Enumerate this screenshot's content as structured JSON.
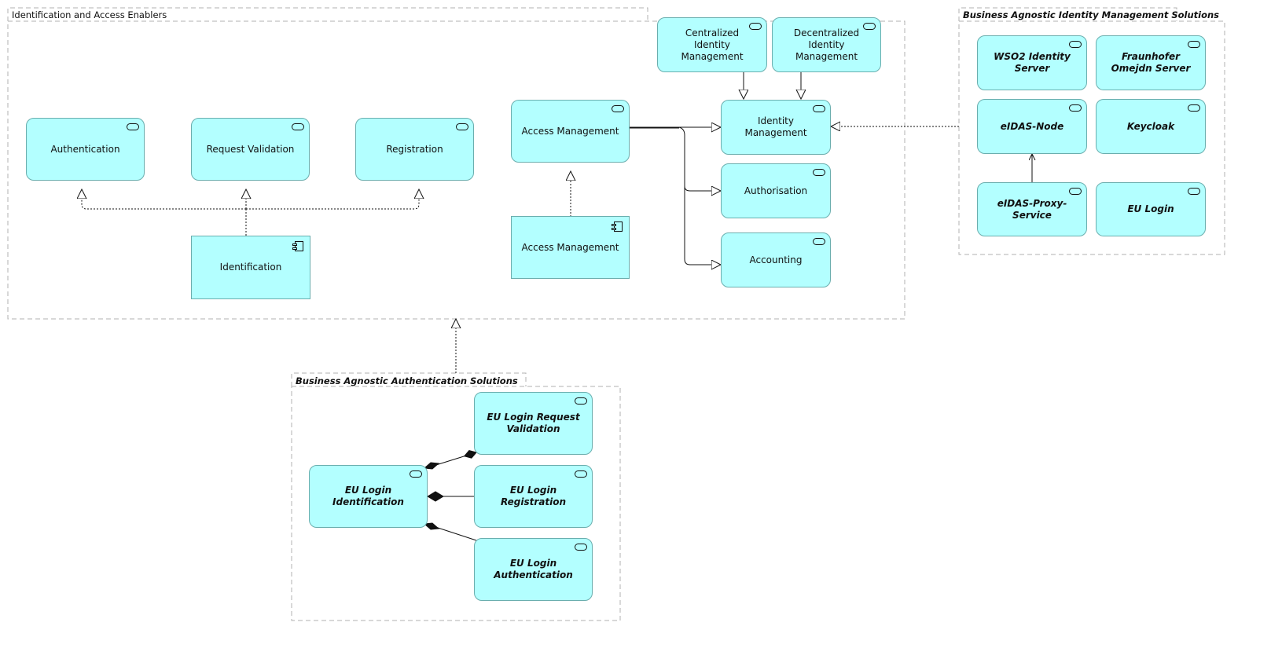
{
  "groups": {
    "enablers": {
      "title": "Identification and Access Enablers"
    },
    "identity_solutions": {
      "title": "Business Agnostic Identity Management Solutions"
    },
    "auth_solutions": {
      "title": "Business Agnostic Authentication Solutions"
    }
  },
  "nodes": {
    "authentication": {
      "label": "Authentication",
      "type": "service"
    },
    "request_validation": {
      "label": "Request Validation",
      "type": "service"
    },
    "registration": {
      "label": "Registration",
      "type": "service"
    },
    "identification": {
      "label": "Identification",
      "type": "component"
    },
    "access_management_service": {
      "label": "Access Management",
      "type": "service"
    },
    "access_management_component": {
      "label": "Access Management",
      "type": "component"
    },
    "centralized_idm": {
      "label": "Centralized Identity Management",
      "type": "service"
    },
    "decentralized_idm": {
      "label": "Decentralized Identity Management",
      "type": "service"
    },
    "identity_management": {
      "label": "Identity Management",
      "type": "service"
    },
    "authorisation": {
      "label": "Authorisation",
      "type": "service"
    },
    "accounting": {
      "label": "Accounting",
      "type": "service"
    },
    "wso2": {
      "label": "WSO2 Identity Server",
      "type": "service"
    },
    "fraunhofer": {
      "label": "Fraunhofer Omejdn Server",
      "type": "service"
    },
    "eidas_node": {
      "label": "eIDAS-Node",
      "type": "service"
    },
    "keycloak": {
      "label": "Keycloak",
      "type": "service"
    },
    "eidas_proxy": {
      "label": "eIDAS-Proxy-Service",
      "type": "service"
    },
    "eu_login": {
      "label": "EU Login",
      "type": "service"
    },
    "eu_login_request_validation": {
      "label": "EU Login Request Validation",
      "type": "service"
    },
    "eu_login_identification": {
      "label": "EU Login Identification",
      "type": "service"
    },
    "eu_login_registration": {
      "label": "EU Login Registration",
      "type": "service"
    },
    "eu_login_authentication": {
      "label": "EU Login Authentication",
      "type": "service"
    }
  },
  "relationships": [
    {
      "from": "identification",
      "to": "authentication",
      "type": "realization"
    },
    {
      "from": "identification",
      "to": "request_validation",
      "type": "realization"
    },
    {
      "from": "identification",
      "to": "registration",
      "type": "realization"
    },
    {
      "from": "access_management_component",
      "to": "access_management_service",
      "type": "realization"
    },
    {
      "from": "access_management_service",
      "to": "identity_management",
      "type": "specialization"
    },
    {
      "from": "access_management_service",
      "to": "authorisation",
      "type": "specialization"
    },
    {
      "from": "access_management_service",
      "to": "accounting",
      "type": "specialization"
    },
    {
      "from": "centralized_idm",
      "to": "identity_management",
      "type": "specialization"
    },
    {
      "from": "decentralized_idm",
      "to": "identity_management",
      "type": "specialization"
    },
    {
      "from": "identity_solutions",
      "to": "identity_management",
      "type": "realization"
    },
    {
      "from": "eidas_proxy",
      "to": "eidas_node",
      "type": "serving"
    },
    {
      "from": "auth_solutions",
      "to": "enablers",
      "type": "realization"
    },
    {
      "from": "eu_login_identification",
      "to": "eu_login_request_validation",
      "type": "composition"
    },
    {
      "from": "eu_login_identification",
      "to": "eu_login_registration",
      "type": "composition"
    },
    {
      "from": "eu_login_identification",
      "to": "eu_login_authentication",
      "type": "composition"
    }
  ]
}
